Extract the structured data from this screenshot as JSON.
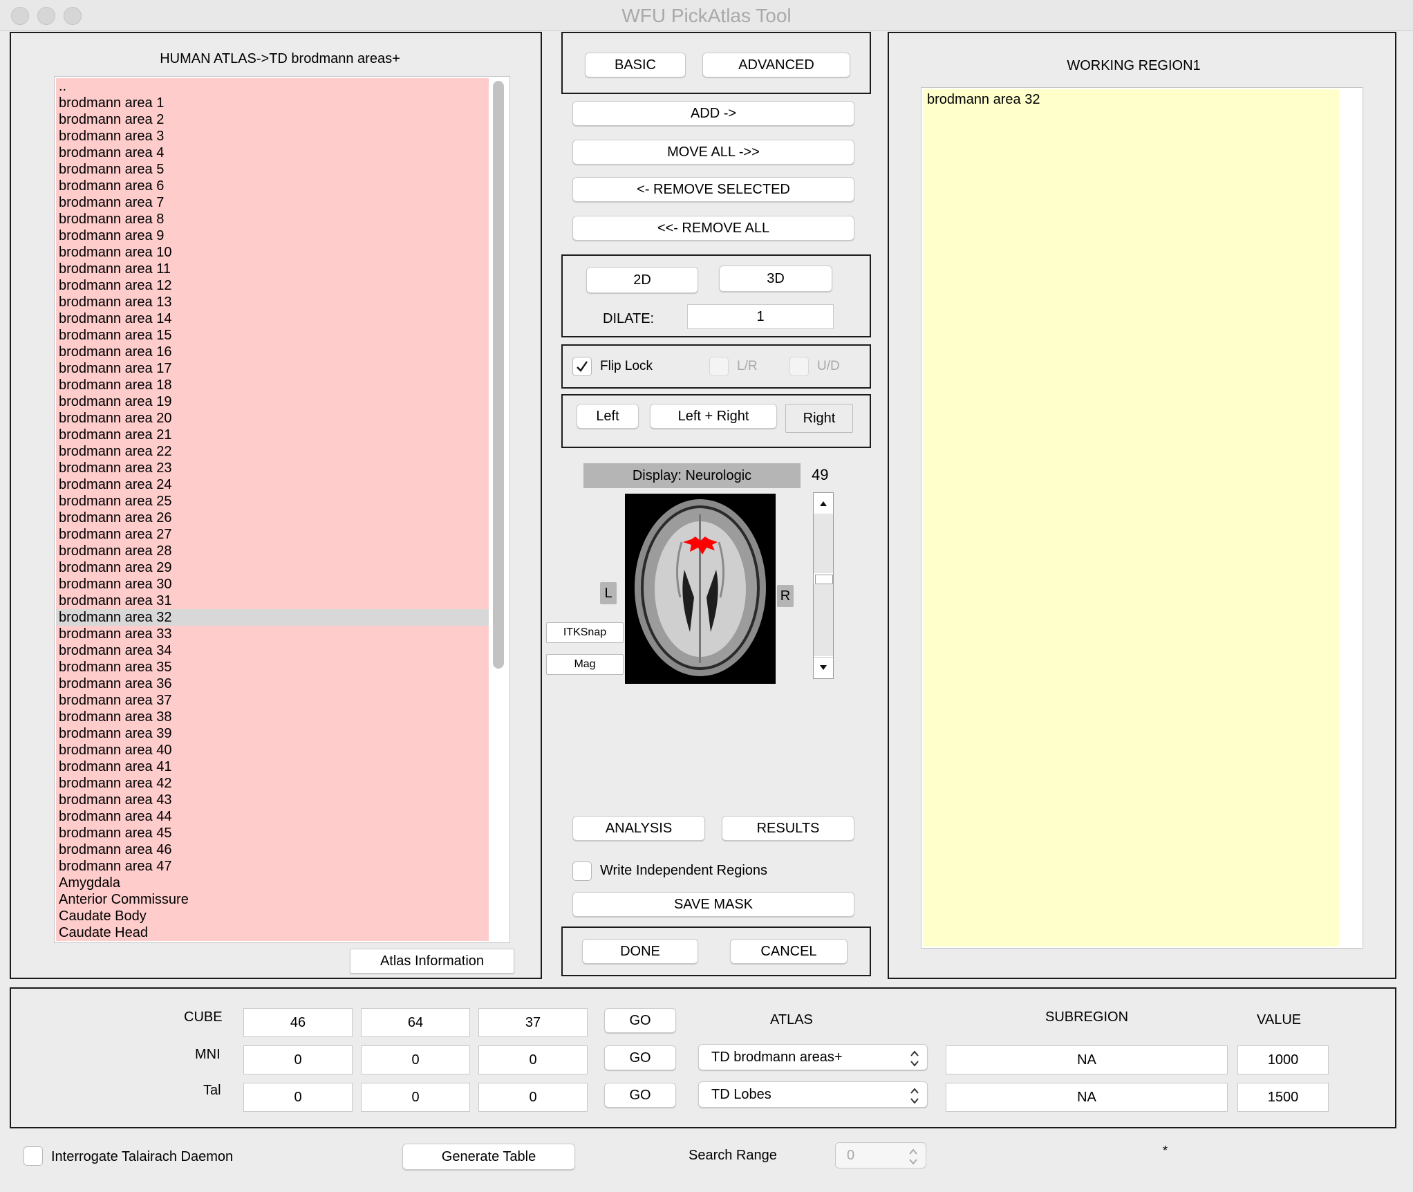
{
  "window": {
    "title": "WFU PickAtlas Tool"
  },
  "atlas_list": {
    "header": "HUMAN ATLAS->TD brodmann areas+",
    "items": [
      "..",
      "brodmann area 1",
      "brodmann area 2",
      "brodmann area 3",
      "brodmann area 4",
      "brodmann area 5",
      "brodmann area 6",
      "brodmann area 7",
      "brodmann area 8",
      "brodmann area 9",
      "brodmann area 10",
      "brodmann area 11",
      "brodmann area 12",
      "brodmann area 13",
      "brodmann area 14",
      "brodmann area 15",
      "brodmann area 16",
      "brodmann area 17",
      "brodmann area 18",
      "brodmann area 19",
      "brodmann area 20",
      "brodmann area 21",
      "brodmann area 22",
      "brodmann area 23",
      "brodmann area 24",
      "brodmann area 25",
      "brodmann area 26",
      "brodmann area 27",
      "brodmann area 28",
      "brodmann area 29",
      "brodmann area 30",
      "brodmann area 31",
      "brodmann area 32",
      "brodmann area 33",
      "brodmann area 34",
      "brodmann area 35",
      "brodmann area 36",
      "brodmann area 37",
      "brodmann area 38",
      "brodmann area 39",
      "brodmann area 40",
      "brodmann area 41",
      "brodmann area 42",
      "brodmann area 43",
      "brodmann area 44",
      "brodmann area 45",
      "brodmann area 46",
      "brodmann area 47",
      "Amygdala",
      "Anterior Commissure",
      "Caudate Body",
      "Caudate Head"
    ],
    "selected": "brodmann area 32",
    "info_button": "Atlas Information",
    "background_color": "#ffcccc"
  },
  "mode": {
    "basic": "BASIC",
    "advanced": "ADVANCED"
  },
  "actions": {
    "add": "ADD ->",
    "move_all": "MOVE ALL ->>",
    "remove_selected": "<- REMOVE SELECTED",
    "remove_all": "<<- REMOVE ALL"
  },
  "dims": {
    "two_d": "2D",
    "three_d": "3D",
    "dilate_label": "DILATE:",
    "dilate_value": "1"
  },
  "flip": {
    "flip_lock": "Flip Lock",
    "flip_lock_checked": true,
    "lr": "L/R",
    "ud": "U/D"
  },
  "hemisphere": {
    "left": "Left",
    "left_right": "Left + Right",
    "right": "Right",
    "selected": "Right"
  },
  "viewer": {
    "display_label": "Display: Neurologic",
    "slice_number": "49",
    "left_marker": "L",
    "right_marker": "R",
    "itksnap": "ITKSnap",
    "mag": "Mag",
    "highlight_color": "#ff0000"
  },
  "analysis": {
    "analysis": "ANALYSIS",
    "results": "RESULTS",
    "write_independent": "Write Independent Regions",
    "save_mask": "SAVE MASK"
  },
  "confirm": {
    "done": "DONE",
    "cancel": "CANCEL"
  },
  "working_region": {
    "title": "WORKING REGION1",
    "items": [
      "brodmann area 32"
    ],
    "background_color": "#ffffcc"
  },
  "coords": {
    "cube_label": "CUBE",
    "mni_label": "MNI",
    "tal_label": "Tal",
    "go": "GO",
    "cube": [
      "46",
      "64",
      "37"
    ],
    "mni": [
      "0",
      "0",
      "0"
    ],
    "tal": [
      "0",
      "0",
      "0"
    ],
    "atlas_header": "ATLAS",
    "subregion_header": "SUBREGION",
    "value_header": "VALUE",
    "atlas1": "TD brodmann areas+",
    "atlas2": "TD Lobes",
    "subregion1": "NA",
    "subregion2": "NA",
    "value1": "1000",
    "value2": "1500"
  },
  "footer": {
    "interrogate": "Interrogate Talairach Daemon",
    "generate_table": "Generate Table",
    "search_range_label": "Search Range",
    "search_range_value": "0",
    "asterisk": "*"
  }
}
